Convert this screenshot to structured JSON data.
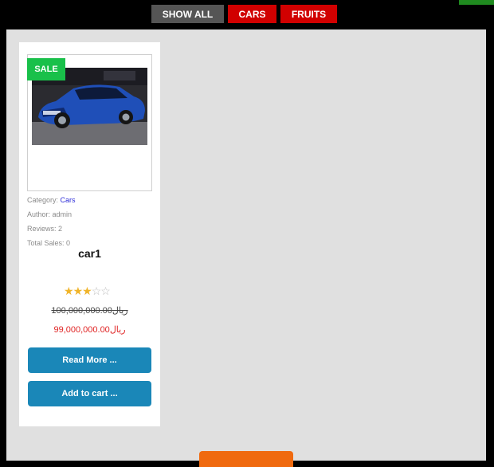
{
  "filters": [
    {
      "label": "SHOW ALL",
      "color": "#555555"
    },
    {
      "label": "CARS",
      "color": "#d10000"
    },
    {
      "label": "FRUITS",
      "color": "#d10000"
    }
  ],
  "product": {
    "badge": "SALE",
    "category_label": "Category:",
    "category": "Cars",
    "author_label": "Author:",
    "author": "admin",
    "reviews_label": "Reviews:",
    "reviews": "2",
    "sales_label": "Total Sales:",
    "sales": "0",
    "title": "car1",
    "rating": 3,
    "rating_max": 5,
    "price_old": "100,000,000.00ریال",
    "price_new": "99,000,000.00ریال",
    "read_more": "Read More ...",
    "add_to_cart": "Add to cart ..."
  },
  "colors": {
    "badge": "#19c04a",
    "button": "#1a87b8",
    "price_new": "#e02424",
    "accent_orange": "#f06a0f"
  }
}
